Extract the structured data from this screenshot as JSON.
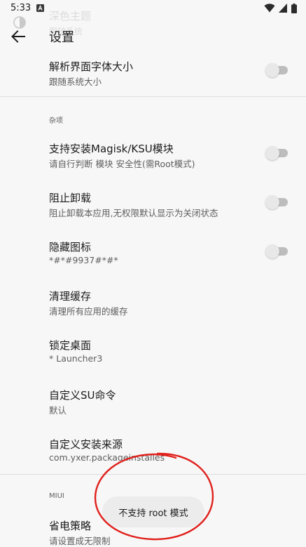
{
  "status_bar": {
    "time": "5:33",
    "icons": [
      "a-notification-icon",
      "wifi-icon",
      "signal-icon",
      "battery-icon"
    ]
  },
  "ghost": {
    "title": "深色主题",
    "subtitle": "跟随系统"
  },
  "app_bar": {
    "title": "设置",
    "back_icon": "arrow-back-icon"
  },
  "items_top": [
    {
      "title": "解析界面字体大小",
      "summary": "跟随系统大小",
      "switch": false
    }
  ],
  "sections": [
    {
      "header": "杂项",
      "items": [
        {
          "title": "支持安装Magisk/KSU模块",
          "summary": "请自行判断 模块 安全性(需Root模式)",
          "switch": false
        },
        {
          "title": "阻止卸载",
          "summary": "阻止卸载本应用,无权限默认显示为关闭状态",
          "switch": false
        },
        {
          "title": "隐藏图标",
          "summary": "*#*#9937#*#*",
          "switch": false
        },
        {
          "title": "清理缓存",
          "summary": "清理所有应用的缓存"
        },
        {
          "title": "锁定桌面",
          "summary": "* Launcher3"
        },
        {
          "title": "自定义SU命令",
          "summary": "默认"
        },
        {
          "title": "自定义安装来源",
          "summary": "com.yxer.packageinstalles"
        }
      ]
    },
    {
      "header": "MIUI",
      "items": [
        {
          "title": "省电策略",
          "summary": "请设置成无限制"
        }
      ]
    }
  ],
  "toast": {
    "message": "不支持 root 模式"
  },
  "colors": {
    "background": "#f7f7f7",
    "switch_track_off": "#bdbdbd",
    "switch_thumb_off": "#e8e8e8",
    "annotation_circle": "#e0201b",
    "toast_background": "#ececec"
  }
}
